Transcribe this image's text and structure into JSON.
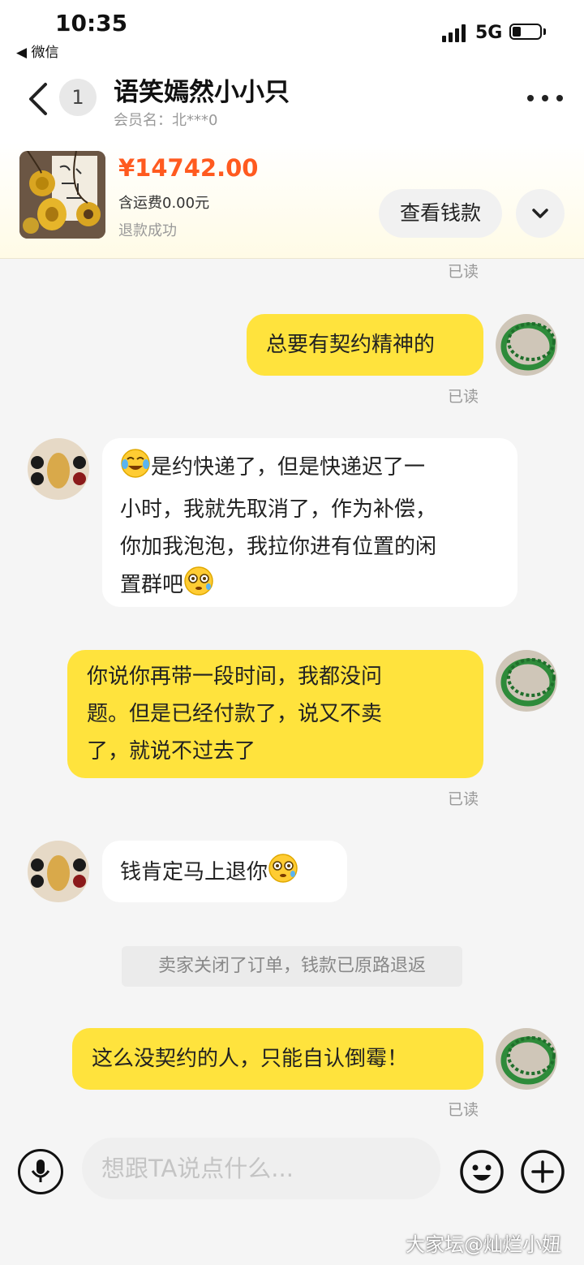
{
  "status_bar": {
    "time": "10:35",
    "back_app": "◀ 微信",
    "network": "5G"
  },
  "header": {
    "unread_count": "1",
    "title": "语笑嫣然小小只",
    "member_name": "会员名：北***0"
  },
  "product": {
    "price": "¥14742.00",
    "shipping": "含运费0.00元",
    "status": "退款成功",
    "view_button": "查看钱款"
  },
  "messages": [
    {
      "text": "总要有契约精神的"
    },
    {
      "line1": "是约快递了，但是快递迟了一",
      "line2": "小时，我就先取消了，作为补偿，",
      "line3": "你加我泡泡，我拉你进有位置的闲",
      "line4": "置群吧"
    },
    {
      "line1": "你说你再带一段时间，我都没问",
      "line2": "题。但是已经付款了，说又不卖",
      "line3": "了，就说不过去了"
    },
    {
      "text": "钱肯定马上退你"
    },
    {
      "text": "这么没契约的人，只能自认倒霉！"
    }
  ],
  "read_label": "已读",
  "system_message": "卖家关闭了订单，钱款已原路退返",
  "input": {
    "placeholder": "想跟TA说点什么..."
  },
  "watermark": "大家坛@灿烂小妞",
  "colors": {
    "accent_yellow": "#ffe33d",
    "price_orange": "#ff5a1f"
  }
}
